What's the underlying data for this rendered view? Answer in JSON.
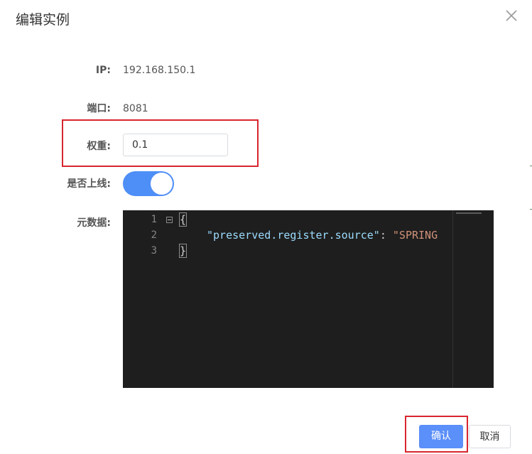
{
  "dialog": {
    "title": "编辑实例"
  },
  "form": {
    "ip_label": "IP:",
    "ip_value": "192.168.150.1",
    "port_label": "端口:",
    "port_value": "8081",
    "weight_label": "权重:",
    "weight_value": "0.1",
    "online_label": "是否上线:",
    "online_enabled": true,
    "metadata_label": "元数据:"
  },
  "editor": {
    "line_numbers": [
      "1",
      "2",
      "3"
    ],
    "open_brace": "{",
    "close_brace": "}",
    "key": "\"preserved.register.source\"",
    "colon": ": ",
    "value": "\"SPRING"
  },
  "footer": {
    "confirm_label": "确认",
    "cancel_label": "取消"
  },
  "colors": {
    "primary": "#5b8ff9",
    "switch_on": "#4e8ef7",
    "highlight": "#d8262e",
    "editor_bg": "#1e1e1e"
  },
  "icons": {
    "close": "close-icon",
    "fold": "fold-icon"
  }
}
